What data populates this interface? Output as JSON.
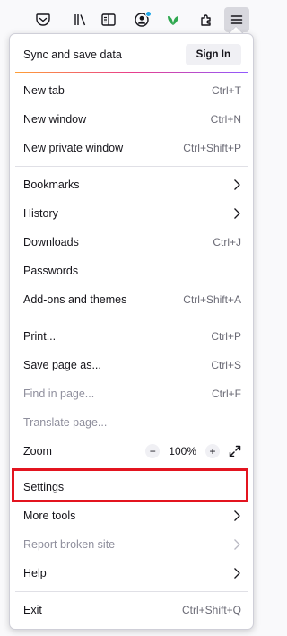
{
  "toolbar": {
    "icons": [
      "pocket-icon",
      "library-icon",
      "reader-view-icon",
      "account-icon",
      "extension-leaf-icon",
      "extensions-puzzle-icon",
      "hamburger-menu-icon"
    ]
  },
  "menu": {
    "sync": {
      "label": "Sync and save data",
      "button": "Sign In"
    },
    "items": {
      "new_tab": {
        "label": "New tab",
        "shortcut": "Ctrl+T"
      },
      "new_window": {
        "label": "New window",
        "shortcut": "Ctrl+N"
      },
      "new_private_window": {
        "label": "New private window",
        "shortcut": "Ctrl+Shift+P"
      },
      "bookmarks": {
        "label": "Bookmarks"
      },
      "history": {
        "label": "History"
      },
      "downloads": {
        "label": "Downloads",
        "shortcut": "Ctrl+J"
      },
      "passwords": {
        "label": "Passwords"
      },
      "addons": {
        "label": "Add-ons and themes",
        "shortcut": "Ctrl+Shift+A"
      },
      "print": {
        "label": "Print...",
        "shortcut": "Ctrl+P"
      },
      "save_page": {
        "label": "Save page as...",
        "shortcut": "Ctrl+S"
      },
      "find_in_page": {
        "label": "Find in page...",
        "shortcut": "Ctrl+F"
      },
      "translate_page": {
        "label": "Translate page..."
      },
      "zoom": {
        "label": "Zoom",
        "minus": "−",
        "level": "100%",
        "plus": "+"
      },
      "settings": {
        "label": "Settings"
      },
      "more_tools": {
        "label": "More tools"
      },
      "report_broken_site": {
        "label": "Report broken site"
      },
      "help": {
        "label": "Help"
      },
      "exit": {
        "label": "Exit",
        "shortcut": "Ctrl+Shift+Q"
      }
    }
  },
  "colors": {
    "highlight": "#e3141f",
    "text": "#15141a",
    "disabled": "#8f8f9d",
    "badge": "#1fa7e8",
    "leaf": "#2fa84f"
  }
}
